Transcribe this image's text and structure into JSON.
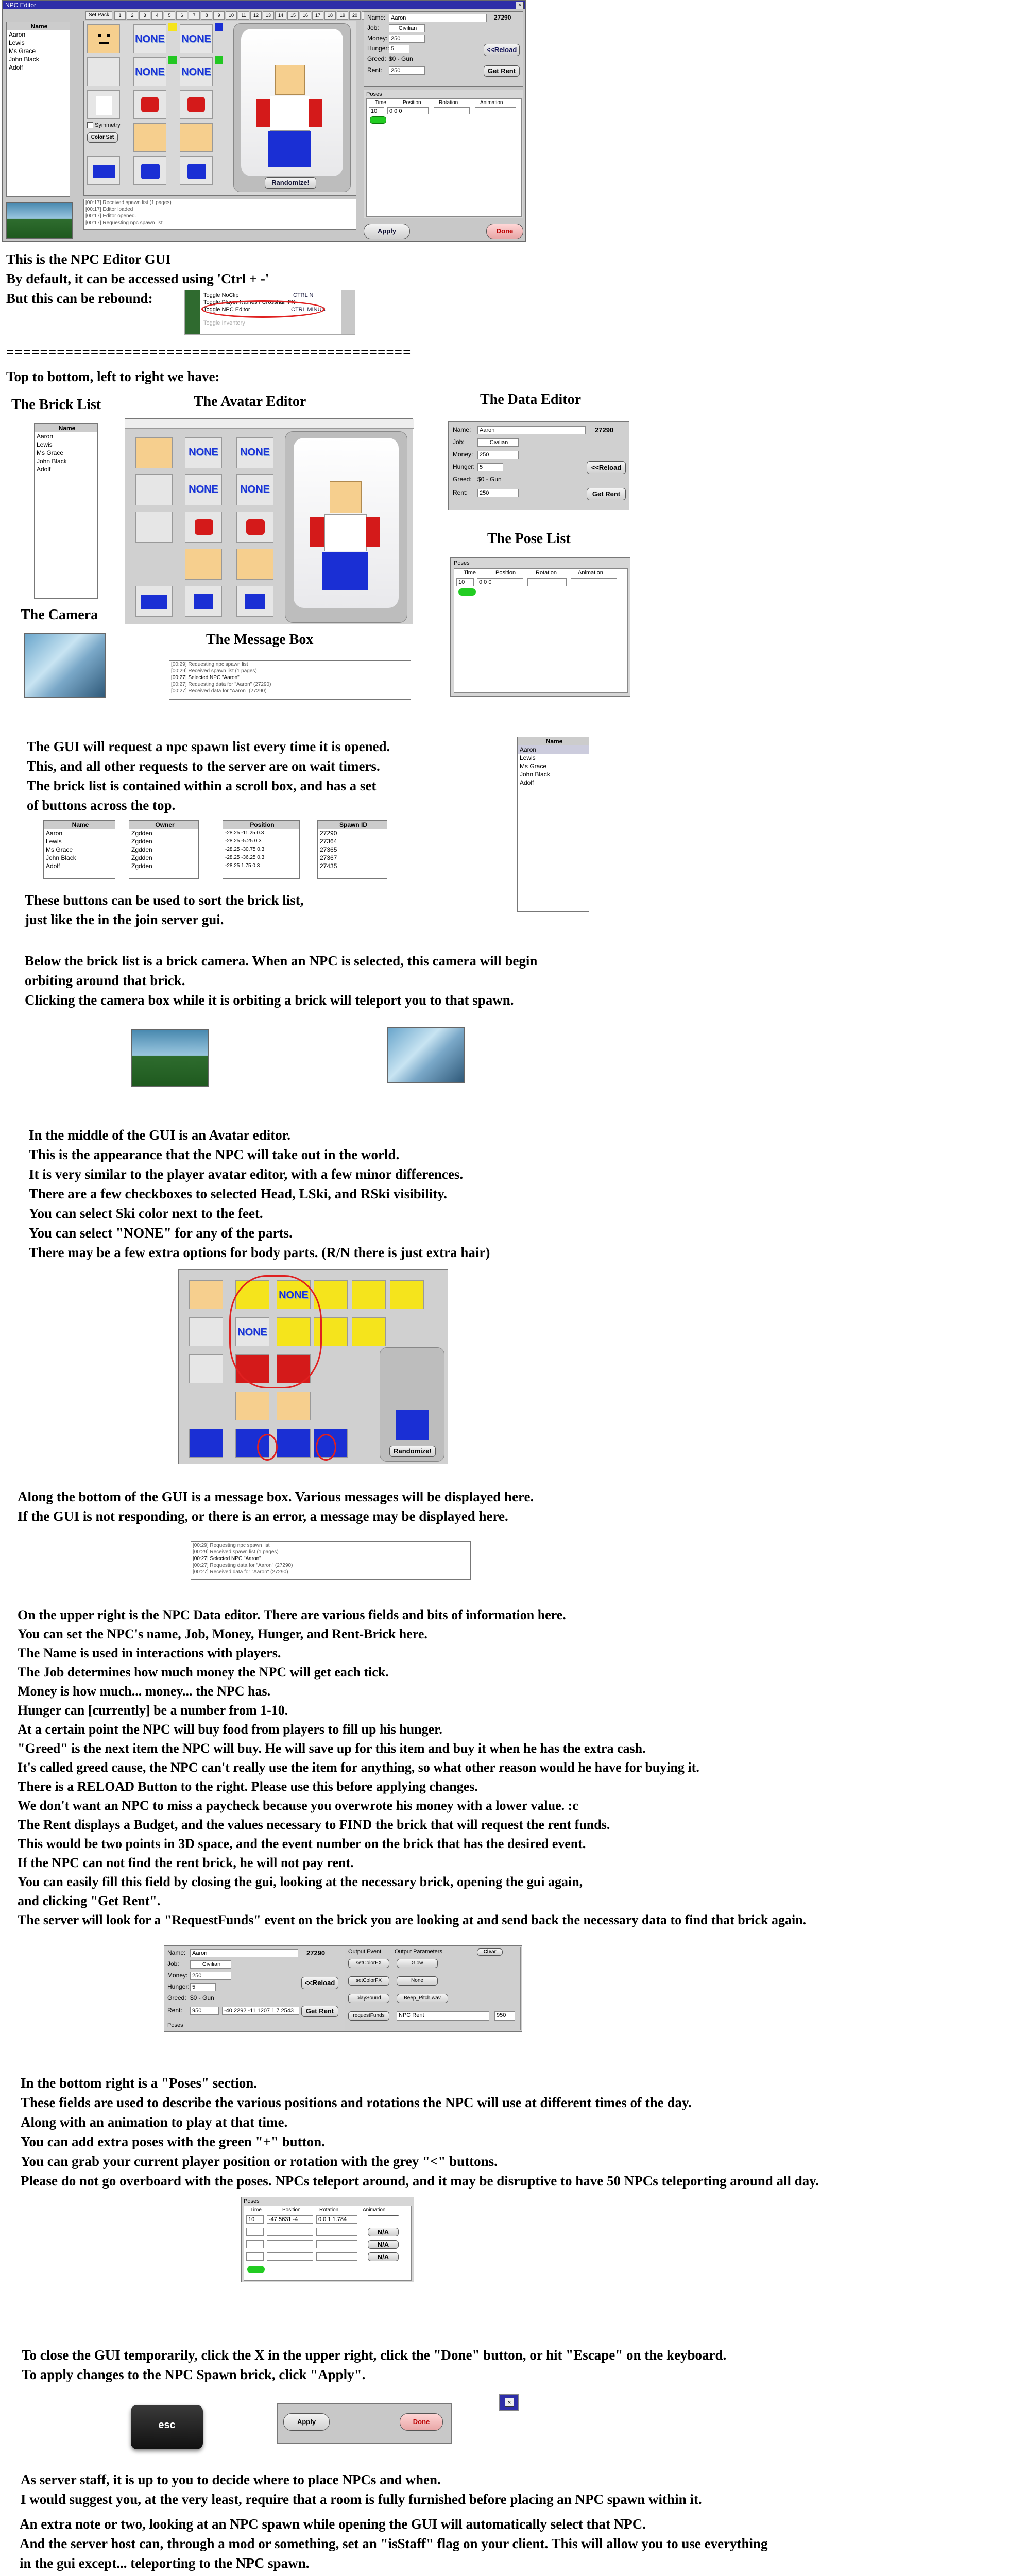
{
  "window": {
    "title": "NPC Editor",
    "tabs_label": "Set Pack",
    "tab_numbers": [
      "1",
      "2",
      "3",
      "4",
      "5",
      "6",
      "7",
      "8",
      "9",
      "10",
      "11",
      "12",
      "13",
      "14",
      "15",
      "16",
      "17",
      "18",
      "19",
      "20",
      "21",
      "22",
      "23",
      "24",
      "25",
      "26",
      "27",
      "28",
      "29",
      "30",
      "31",
      "32"
    ],
    "none_label": "NONE",
    "symmetry_label": "Symmetry",
    "color_set_label": "Color Set",
    "randomize_label": "Randomize!",
    "apply_label": "Apply",
    "done_label": "Done",
    "reload_label": "<<Reload",
    "get_rent_label": "Get Rent",
    "poses_label": "Poses"
  },
  "brick_list": {
    "header": "Name",
    "items": [
      "Aaron",
      "Lewis",
      "Ms Grace",
      "John Black",
      "Adolf"
    ]
  },
  "data_editor": {
    "name_label": "Name:",
    "name_value": "Aaron",
    "id_value": "27290",
    "job_label": "Job:",
    "job_value": "Civilian",
    "money_label": "Money:",
    "money_value": "250",
    "hunger_label": "Hunger:",
    "hunger_value": "5",
    "greed_label": "Greed:",
    "greed_value": "$0 - Gun",
    "rent_label": "Rent:",
    "rent_value": "250"
  },
  "poses_table": {
    "columns": [
      "Time",
      "Position",
      "Rotation",
      "Animation"
    ],
    "row_values": [
      "10",
      "0 0 0"
    ]
  },
  "messages": [
    "[00:17] Received spawn list (1 pages)",
    "[00:17] Editor loaded",
    "[00:17] Editor opened.",
    "[00:17] Requesting npc spawn list",
    "[00:17] Received spawn list (1 pages)"
  ],
  "messages2": [
    "[00:29] Requesting npc spawn list",
    "[00:29] Received spawn list (1 pages)",
    "[00:27] Selected NPC \"Aaron\"",
    "[00:27] Requesting data for \"Aaron\" (27290)",
    "[00:27] Received data for \"Aaron\" (27290)"
  ],
  "intro": {
    "line1": "This is the NPC Editor GUI",
    "line2": "By default, it can be accessed using 'Ctrl + -'",
    "line3": "But this can be rebound:",
    "keybind_rows": [
      "Toggle NoClip",
      "Toggle Player Names / Crosshair FX",
      "Toggle NPC Editor",
      "Toggle Inventory"
    ],
    "keybind_keys": [
      "CTRL N",
      "CTRL MINUS"
    ],
    "divider": "================================================",
    "top_to_bottom": "Top to bottom, left to right we have:"
  },
  "labels": {
    "brick_list": "The Brick List",
    "avatar_editor": "The Avatar Editor",
    "data_editor": "The Data Editor",
    "pose_list": "The Pose List",
    "camera": "The Camera",
    "message_box": "The Message Box"
  },
  "sort_columns": [
    {
      "header": "Name",
      "rows": [
        "Aaron",
        "Lewis",
        "Ms Grace",
        "John Black",
        "Adolf"
      ]
    },
    {
      "header": "Owner",
      "rows": [
        "Zgdden",
        "Zgdden",
        "Zgdden",
        "Zgdden",
        "Zgdden"
      ]
    },
    {
      "header": "Position",
      "rows": [
        "-28.25 -11.25 0.3",
        "-28.25 -5.25 0.3",
        "-28.25 -30.75 0.3",
        "-28.25 -36.25 0.3",
        "-28.25 1.75 0.3"
      ]
    },
    {
      "header": "Spawn ID",
      "rows": [
        "27290",
        "27364",
        "27365",
        "27367",
        "27435"
      ]
    }
  ],
  "paragraphs": {
    "spawn_list": "The GUI will request a npc spawn list every time it is opened.\nThis, and all other requests to the server are on wait timers.\nThe brick list is contained within a scroll box, and has a set\nof buttons across the top.",
    "sort": "These buttons can be used to sort the brick list,\njust like the in the join server gui.",
    "camera": "Below the brick list is a brick camera.  When an NPC is selected, this camera will begin\norbiting around that brick.\nClicking the camera box while it is orbiting a brick will teleport you to that spawn.",
    "avatar": "In the middle of the GUI is an Avatar editor.\nThis is the appearance that the NPC will take out in the world.\nIt is very similar to the player avatar editor, with a few minor differences.\nThere are a few checkboxes to selected Head, LSki, and RSki visibility.\nYou can select Ski color next to the feet.\nYou can select \"NONE\" for any of the parts.\nThere may be a few extra options for body parts.  (R/N there is just extra hair)",
    "message": "Along the bottom of the GUI is a message box.  Various messages will be displayed here.\nIf the GUI is not responding, or there is an error, a message may be displayed here.",
    "data": "On the upper right is the NPC Data editor.  There are various fields and bits of information here.\nYou can set the NPC's name, Job, Money, Hunger, and Rent-Brick here.\nThe Name is used in interactions with players.\nThe Job determines how much money the NPC will get each tick.\nMoney is how much... money... the NPC has.\nHunger can [currently] be a number from 1-10.\nAt a certain point the NPC will buy food from players to fill up his hunger.\n\"Greed\" is the next item the NPC will buy.  He will save up for this item and buy it when he has the extra cash.\nIt's called greed cause, the NPC can't really use the item for anything, so what other reason would he have for buying it.\nThere is a RELOAD Button to the right.  Please use this before applying changes.\nWe don't want an NPC to miss a paycheck because you overwrote his money with a lower value. :c\nThe Rent displays a Budget, and the values necessary to FIND the brick that will request the rent funds.\nThis would be two points in 3D space, and the event number on the brick that has the desired event.\nIf the NPC can not find the rent brick, he will not pay rent.\nYou can easily fill this field by closing the gui, looking at the necessary brick, opening the gui again,\nand clicking \"Get Rent\".\nThe server will look for a \"RequestFunds\" event on the brick you are looking at and send back the necessary data to find that brick again.",
    "poses": "In the bottom right is a \"Poses\" section.\nThese fields are used to describe the various positions and rotations the NPC will use at different times of the day.\nAlong with an animation to play at that time.\nYou can add extra poses with the green \"+\" button.\nYou can grab your current player position or rotation with the grey \"<\" buttons.\nPlease do not go overboard with the poses.  NPCs teleport around, and it may be disruptive to have 50 NPCs teleporting around all day.",
    "close": "To close the GUI temporarily, click the X in the upper right, click the \"Done\" button, or hit \"Escape\" on the keyboard.\nTo apply changes to the NPC Spawn brick, click \"Apply\".",
    "staff": "As server staff, it is up to you to decide where to place NPCs and when.\nI would suggest you, at the very least, require that a room is fully furnished before placing an NPC spawn within it.",
    "extra": "An extra note or two, looking at an NPC spawn while opening the GUI will automatically select that NPC.\nAnd the server host can, through a mod or something, set an \"isStaff\" flag on your client.  This will allow you to use everything\nin the gui except... teleporting to the NPC spawn."
  },
  "rent_detail": {
    "rent_value": "950",
    "rent_points": "-40 2292 -11 1207 1 7 2543",
    "events_header": [
      "Output Event",
      "Output Parameters"
    ],
    "clear_label": "Clear",
    "events": [
      {
        "event": "setColorFX",
        "param": "Glow"
      },
      {
        "event": "setColorFX",
        "param": "None"
      },
      {
        "event": "playSound",
        "param": "Beep_Pitch.wav"
      },
      {
        "event": "requestFunds",
        "param": "NPC Rent"
      }
    ],
    "event_extra": "950"
  },
  "poses_detail": {
    "rows": [
      {
        "time": "10",
        "pos": "-47 5631 -4",
        "rot": "0 0 1 1.784",
        "anim": ""
      },
      {
        "time": "",
        "pos": "",
        "rot": "",
        "anim": "N/A"
      },
      {
        "time": "",
        "pos": "",
        "rot": "",
        "anim": "N/A"
      },
      {
        "time": "",
        "pos": "",
        "rot": "",
        "anim": "N/A"
      }
    ]
  },
  "esc_key": "esc"
}
